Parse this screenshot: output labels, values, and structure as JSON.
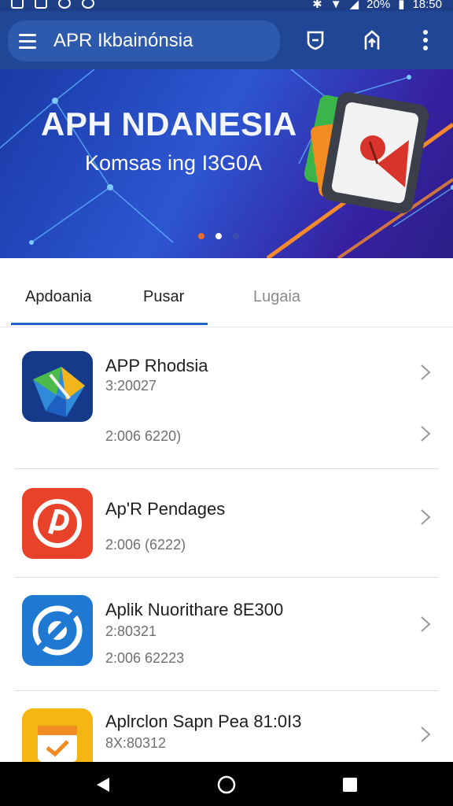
{
  "status_bar": {
    "battery": "20%",
    "time": "18:50"
  },
  "app_bar": {
    "title": "APR Ikbainónsia"
  },
  "banner": {
    "title": "APH NDANESIA",
    "subtitle": "Komsas ing I3G0A",
    "slides": 3,
    "active_slide": 2
  },
  "tabs": [
    {
      "label": "Apdoania"
    },
    {
      "label": "Pusar"
    },
    {
      "label": "Lugaia"
    }
  ],
  "apps": [
    {
      "name": "APP Rhodsia",
      "meta1": "3:20027",
      "meta2": "2:006 6220)",
      "icon": "maps-icon"
    },
    {
      "name": "Ap'R Pendages",
      "meta1": "",
      "meta2": "2:006 (6222)",
      "icon": "music-icon"
    },
    {
      "name": "Aplik Nuorithare 8E300",
      "meta1": "2:80321",
      "meta2": "2:006 62223",
      "icon": "sync-icon"
    },
    {
      "name": "Aplrclon Sapn Pea 81:0I3",
      "meta1": "8X:80312",
      "meta2": "",
      "icon": "calendar-icon"
    }
  ],
  "colors": {
    "app_bar": "#1f4795",
    "accent": "#1f63c7",
    "banner_start": "#1a3aa6",
    "banner_end": "#2a1f86"
  }
}
